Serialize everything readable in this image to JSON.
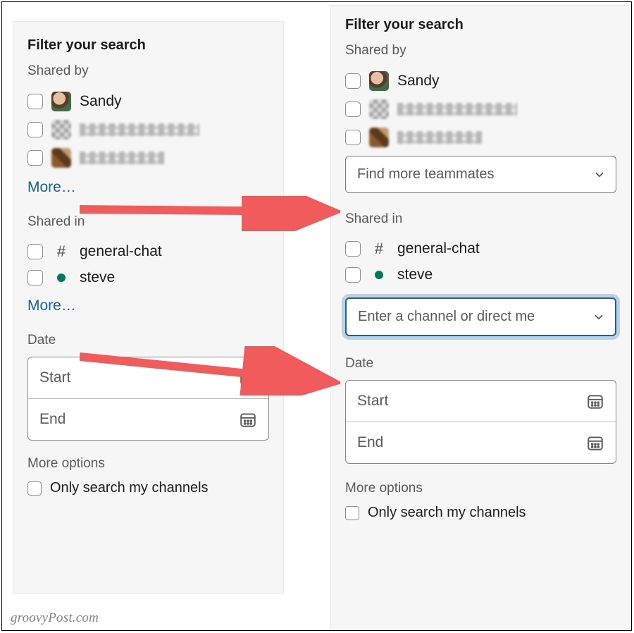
{
  "left": {
    "title": "Filter your search",
    "shared_by_label": "Shared by",
    "people": [
      {
        "name": "Sandy",
        "redacted": false
      },
      {
        "name": "",
        "redacted": true
      },
      {
        "name": "",
        "redacted": true
      }
    ],
    "more_people": "More…",
    "shared_in_label": "Shared in",
    "channels": [
      {
        "kind": "channel",
        "name": "general-chat"
      },
      {
        "kind": "dm",
        "name": "steve"
      }
    ],
    "more_channels": "More…",
    "date_label": "Date",
    "date_start": "Start",
    "date_end": "End",
    "more_options_label": "More options",
    "only_my_channels": "Only search my channels"
  },
  "right": {
    "title": "Filter your search",
    "shared_by_label": "Shared by",
    "people": [
      {
        "name": "Sandy",
        "redacted": false
      },
      {
        "name": "",
        "redacted": true
      },
      {
        "name": "",
        "redacted": true
      }
    ],
    "teammates_placeholder": "Find more teammates",
    "shared_in_label": "Shared in",
    "channels": [
      {
        "kind": "channel",
        "name": "general-chat"
      },
      {
        "kind": "dm",
        "name": "steve"
      }
    ],
    "channel_placeholder": "Enter a channel or direct me",
    "date_label": "Date",
    "date_start": "Start",
    "date_end": "End",
    "more_options_label": "More options",
    "only_my_channels": "Only search my channels"
  },
  "watermark": "groovyPost.com",
  "colors": {
    "link": "#1264a3",
    "accent": "#007a5a",
    "arrow": "#f25b5b"
  }
}
